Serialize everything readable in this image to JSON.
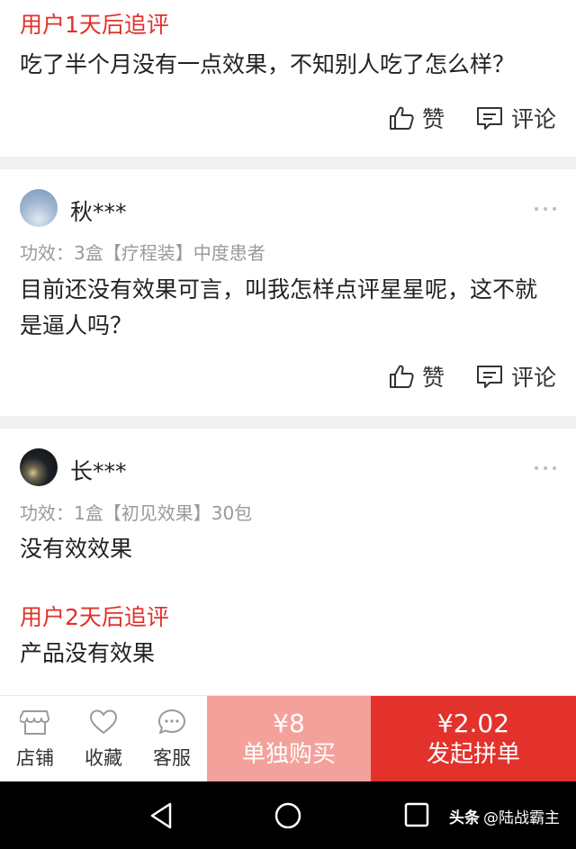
{
  "reviews": [
    {
      "followup_label": "用户1天后追评",
      "followup_text": "吃了半个月没有一点效果，不知别人吃了怎么样？",
      "like_label": "赞",
      "comment_label": "评论"
    },
    {
      "username": "秋***",
      "meta": "功效：3盒【疗程装】中度患者",
      "text": "目前还没有效果可言，叫我怎样点评星星呢，这不就是逼人吗？",
      "like_label": "赞",
      "comment_label": "评论"
    },
    {
      "username": "长***",
      "meta": "功效：1盒【初见效果】30包",
      "text": "没有效效果",
      "followup_label": "用户2天后追评",
      "followup_text": "产品没有效果"
    }
  ],
  "bottom_bar": {
    "store_label": "店铺",
    "favorite_label": "收藏",
    "service_label": "客服",
    "solo_price": "¥8",
    "solo_label": "单独购买",
    "group_price": "¥2.02",
    "group_label": "发起拼单"
  },
  "watermark": {
    "brand": "头条",
    "handle": "@陆战霸主"
  },
  "colors": {
    "accent_red": "#e3322b",
    "solo_pink": "#f4a19c",
    "followup_red": "#e0322a"
  },
  "icons": [
    "thumbs-up-icon",
    "comment-icon",
    "more-icon",
    "store-icon",
    "heart-icon",
    "chat-icon",
    "back-icon",
    "home-icon",
    "recents-icon"
  ]
}
